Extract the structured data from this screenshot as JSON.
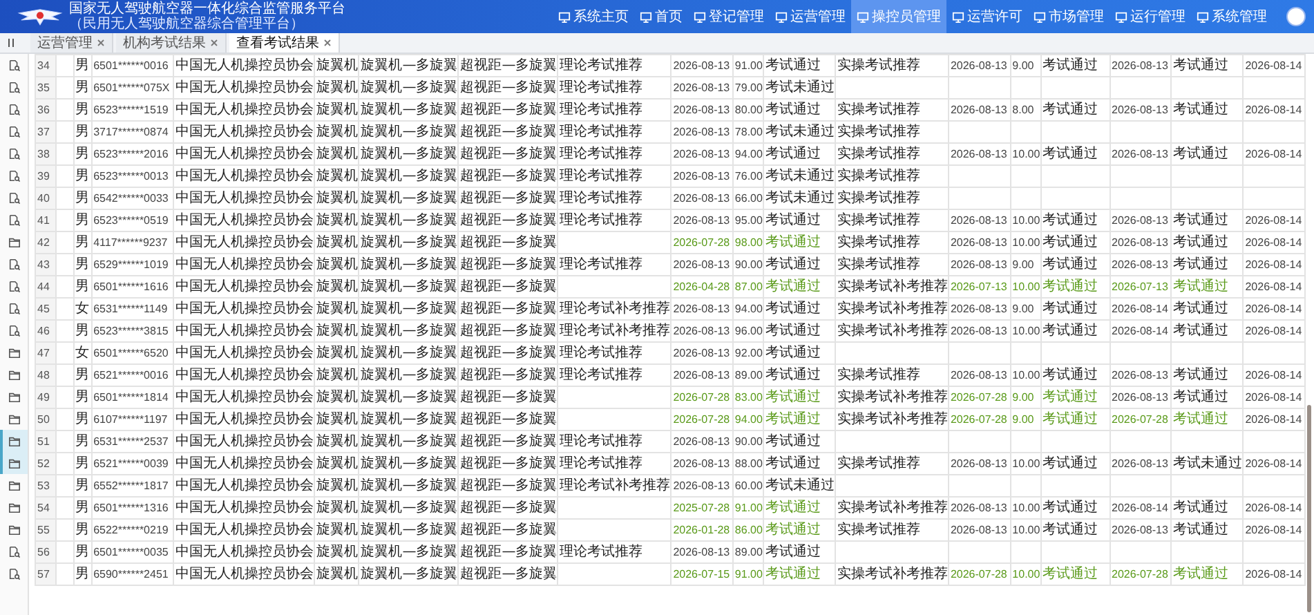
{
  "header": {
    "title": "国家无人驾驶航空器一体化综合监管服务平台",
    "subtitle": "（民用无人驾驶航空器综合管理平台）",
    "nav": [
      {
        "label": "系统主页",
        "selected": false
      },
      {
        "label": "首页",
        "selected": false
      },
      {
        "label": "登记管理",
        "selected": false
      },
      {
        "label": "运营管理",
        "selected": false
      },
      {
        "label": "操控员管理",
        "selected": true
      },
      {
        "label": "运营许可",
        "selected": false
      },
      {
        "label": "市场管理",
        "selected": false
      },
      {
        "label": "运行管理",
        "selected": false
      },
      {
        "label": "系统管理",
        "selected": false
      }
    ]
  },
  "tabs": [
    {
      "label": "运营管理",
      "selected": false
    },
    {
      "label": "机构考试结果",
      "selected": false
    },
    {
      "label": "查看考试结果",
      "selected": true
    }
  ],
  "sidebar": {
    "items": [
      {
        "kind": "doc",
        "selected": false
      },
      {
        "kind": "doc",
        "selected": false
      },
      {
        "kind": "doc",
        "selected": false
      },
      {
        "kind": "doc",
        "selected": false
      },
      {
        "kind": "doc",
        "selected": false
      },
      {
        "kind": "doc",
        "selected": false
      },
      {
        "kind": "doc",
        "selected": false
      },
      {
        "kind": "doc",
        "selected": false
      },
      {
        "kind": "folder",
        "selected": false
      },
      {
        "kind": "doc",
        "selected": false
      },
      {
        "kind": "doc",
        "selected": false
      },
      {
        "kind": "doc",
        "selected": false
      },
      {
        "kind": "doc",
        "selected": false
      },
      {
        "kind": "folder",
        "selected": false
      },
      {
        "kind": "folder",
        "selected": false
      },
      {
        "kind": "folder",
        "selected": false
      },
      {
        "kind": "folder",
        "selected": false
      },
      {
        "kind": "folder",
        "selected": true
      },
      {
        "kind": "folder",
        "selected": true
      },
      {
        "kind": "folder",
        "selected": false
      },
      {
        "kind": "folder",
        "selected": false
      },
      {
        "kind": "folder",
        "selected": false
      },
      {
        "kind": "doc",
        "selected": false
      },
      {
        "kind": "doc",
        "selected": false
      }
    ]
  },
  "table": {
    "rows": [
      {
        "no": "34",
        "gender": "男",
        "id_number": "6501******0016",
        "org": "中国无人机操控员协会",
        "aircraft": "旋翼机",
        "class": "旋翼机—多旋翼",
        "range": "超视距—多旋翼",
        "theory": {
          "recommend": "理论考试推荐",
          "date": "2026-08-13",
          "score": "91.00",
          "result": "考试通过",
          "highlight": false
        },
        "practical": {
          "recommend": "实操考试推荐",
          "date": "2026-08-13",
          "score": "9.00",
          "result": "考试通过",
          "highlight": false
        },
        "final": {
          "date": "2026-08-13",
          "result": "考试通过",
          "highlight": false
        },
        "issue_date": "2026-08-14"
      },
      {
        "no": "35",
        "gender": "男",
        "id_number": "6501******075X",
        "org": "中国无人机操控员协会",
        "aircraft": "旋翼机",
        "class": "旋翼机—多旋翼",
        "range": "超视距—多旋翼",
        "theory": {
          "recommend": "理论考试推荐",
          "date": "2026-08-13",
          "score": "79.00",
          "result": "考试未通过",
          "highlight": false
        }
      },
      {
        "no": "36",
        "gender": "男",
        "id_number": "6523******1519",
        "org": "中国无人机操控员协会",
        "aircraft": "旋翼机",
        "class": "旋翼机—多旋翼",
        "range": "超视距—多旋翼",
        "theory": {
          "recommend": "理论考试推荐",
          "date": "2026-08-13",
          "score": "80.00",
          "result": "考试通过",
          "highlight": false
        },
        "practical": {
          "recommend": "实操考试推荐",
          "date": "2026-08-13",
          "score": "8.00",
          "result": "考试通过",
          "highlight": false
        },
        "final": {
          "date": "2026-08-13",
          "result": "考试通过",
          "highlight": false
        },
        "issue_date": "2026-08-14"
      },
      {
        "no": "37",
        "gender": "男",
        "id_number": "3717******0874",
        "org": "中国无人机操控员协会",
        "aircraft": "旋翼机",
        "class": "旋翼机—多旋翼",
        "range": "超视距—多旋翼",
        "theory": {
          "recommend": "理论考试推荐",
          "date": "2026-08-13",
          "score": "78.00",
          "result": "考试未通过",
          "highlight": false
        },
        "practical": {
          "recommend": "实操考试推荐"
        }
      },
      {
        "no": "38",
        "gender": "男",
        "id_number": "6523******2016",
        "org": "中国无人机操控员协会",
        "aircraft": "旋翼机",
        "class": "旋翼机—多旋翼",
        "range": "超视距—多旋翼",
        "theory": {
          "recommend": "理论考试推荐",
          "date": "2026-08-13",
          "score": "94.00",
          "result": "考试通过",
          "highlight": false
        },
        "practical": {
          "recommend": "实操考试推荐",
          "date": "2026-08-13",
          "score": "10.00",
          "result": "考试通过",
          "highlight": false
        },
        "final": {
          "date": "2026-08-13",
          "result": "考试通过",
          "highlight": false
        },
        "issue_date": "2026-08-14"
      },
      {
        "no": "39",
        "gender": "男",
        "id_number": "6523******0013",
        "org": "中国无人机操控员协会",
        "aircraft": "旋翼机",
        "class": "旋翼机—多旋翼",
        "range": "超视距—多旋翼",
        "theory": {
          "recommend": "理论考试推荐",
          "date": "2026-08-13",
          "score": "76.00",
          "result": "考试未通过",
          "highlight": false
        },
        "practical": {
          "recommend": "实操考试推荐"
        }
      },
      {
        "no": "40",
        "gender": "男",
        "id_number": "6542******0033",
        "org": "中国无人机操控员协会",
        "aircraft": "旋翼机",
        "class": "旋翼机—多旋翼",
        "range": "超视距—多旋翼",
        "theory": {
          "recommend": "理论考试推荐",
          "date": "2026-08-13",
          "score": "66.00",
          "result": "考试未通过",
          "highlight": false
        },
        "practical": {
          "recommend": "实操考试推荐"
        }
      },
      {
        "no": "41",
        "gender": "男",
        "id_number": "6523******0519",
        "org": "中国无人机操控员协会",
        "aircraft": "旋翼机",
        "class": "旋翼机—多旋翼",
        "range": "超视距—多旋翼",
        "theory": {
          "recommend": "理论考试推荐",
          "date": "2026-08-13",
          "score": "95.00",
          "result": "考试通过",
          "highlight": false
        },
        "practical": {
          "recommend": "实操考试推荐",
          "date": "2026-08-13",
          "score": "10.00",
          "result": "考试通过",
          "highlight": false
        },
        "final": {
          "date": "2026-08-13",
          "result": "考试通过",
          "highlight": false
        },
        "issue_date": "2026-08-14"
      },
      {
        "no": "42",
        "gender": "男",
        "id_number": "4117******9237",
        "org": "中国无人机操控员协会",
        "aircraft": "旋翼机",
        "class": "旋翼机—多旋翼",
        "range": "超视距—多旋翼",
        "theory": {
          "date": "2026-07-28",
          "score": "98.00",
          "result": "考试通过",
          "highlight": true
        },
        "practical": {
          "recommend": "实操考试推荐",
          "date": "2026-08-13",
          "score": "10.00",
          "result": "考试通过",
          "highlight": false
        },
        "final": {
          "date": "2026-08-13",
          "result": "考试通过",
          "highlight": false
        },
        "issue_date": "2026-08-14"
      },
      {
        "no": "43",
        "gender": "男",
        "id_number": "6529******1019",
        "org": "中国无人机操控员协会",
        "aircraft": "旋翼机",
        "class": "旋翼机—多旋翼",
        "range": "超视距—多旋翼",
        "theory": {
          "recommend": "理论考试推荐",
          "date": "2026-08-13",
          "score": "90.00",
          "result": "考试通过",
          "highlight": false
        },
        "practical": {
          "recommend": "实操考试推荐",
          "date": "2026-08-13",
          "score": "9.00",
          "result": "考试通过",
          "highlight": false
        },
        "final": {
          "date": "2026-08-13",
          "result": "考试通过",
          "highlight": false
        },
        "issue_date": "2026-08-14"
      },
      {
        "no": "44",
        "gender": "男",
        "id_number": "6501******1616",
        "org": "中国无人机操控员协会",
        "aircraft": "旋翼机",
        "class": "旋翼机—多旋翼",
        "range": "超视距—多旋翼",
        "theory": {
          "date": "2026-04-28",
          "score": "87.00",
          "result": "考试通过",
          "highlight": true
        },
        "practical": {
          "recommend": "实操考试补考推荐",
          "date": "2026-07-13",
          "score": "10.00",
          "result": "考试通过",
          "highlight": true
        },
        "final": {
          "date": "2026-07-13",
          "result": "考试通过",
          "highlight": true
        },
        "issue_date": "2026-08-14"
      },
      {
        "no": "45",
        "gender": "女",
        "id_number": "6531******1149",
        "org": "中国无人机操控员协会",
        "aircraft": "旋翼机",
        "class": "旋翼机—多旋翼",
        "range": "超视距—多旋翼",
        "theory": {
          "recommend": "理论考试补考推荐",
          "date": "2026-08-13",
          "score": "94.00",
          "result": "考试通过",
          "highlight": false
        },
        "practical": {
          "recommend": "实操考试补考推荐",
          "date": "2026-08-13",
          "score": "9.00",
          "result": "考试通过",
          "highlight": false
        },
        "final": {
          "date": "2026-08-14",
          "result": "考试通过",
          "highlight": false
        },
        "issue_date": "2026-08-14"
      },
      {
        "no": "46",
        "gender": "男",
        "id_number": "6523******3815",
        "org": "中国无人机操控员协会",
        "aircraft": "旋翼机",
        "class": "旋翼机—多旋翼",
        "range": "超视距—多旋翼",
        "theory": {
          "recommend": "理论考试补考推荐",
          "date": "2026-08-13",
          "score": "96.00",
          "result": "考试通过",
          "highlight": false
        },
        "practical": {
          "recommend": "实操考试补考推荐",
          "date": "2026-08-13",
          "score": "10.00",
          "result": "考试通过",
          "highlight": false
        },
        "final": {
          "date": "2026-08-14",
          "result": "考试通过",
          "highlight": false
        },
        "issue_date": "2026-08-14"
      },
      {
        "no": "47",
        "gender": "女",
        "id_number": "6501******6520",
        "org": "中国无人机操控员协会",
        "aircraft": "旋翼机",
        "class": "旋翼机—多旋翼",
        "range": "超视距—多旋翼",
        "theory": {
          "recommend": "理论考试推荐",
          "date": "2026-08-13",
          "score": "92.00",
          "result": "考试通过",
          "highlight": false
        }
      },
      {
        "no": "48",
        "gender": "男",
        "id_number": "6521******0016",
        "org": "中国无人机操控员协会",
        "aircraft": "旋翼机",
        "class": "旋翼机—多旋翼",
        "range": "超视距—多旋翼",
        "theory": {
          "recommend": "理论考试推荐",
          "date": "2026-08-13",
          "score": "89.00",
          "result": "考试通过",
          "highlight": false
        },
        "practical": {
          "recommend": "实操考试推荐",
          "date": "2026-08-13",
          "score": "10.00",
          "result": "考试通过",
          "highlight": false
        },
        "final": {
          "date": "2026-08-13",
          "result": "考试通过",
          "highlight": false
        },
        "issue_date": "2026-08-14"
      },
      {
        "no": "49",
        "gender": "男",
        "id_number": "6501******1814",
        "org": "中国无人机操控员协会",
        "aircraft": "旋翼机",
        "class": "旋翼机—多旋翼",
        "range": "超视距—多旋翼",
        "theory": {
          "date": "2026-07-28",
          "score": "83.00",
          "result": "考试通过",
          "highlight": true
        },
        "practical": {
          "recommend": "实操考试补考推荐",
          "date": "2026-07-28",
          "score": "9.00",
          "result": "考试通过",
          "highlight": true
        },
        "final": {
          "date": "2026-08-13",
          "result": "考试通过",
          "highlight": false
        },
        "issue_date": "2026-08-14"
      },
      {
        "no": "50",
        "gender": "男",
        "id_number": "6107******1197",
        "org": "中国无人机操控员协会",
        "aircraft": "旋翼机",
        "class": "旋翼机—多旋翼",
        "range": "超视距—多旋翼",
        "theory": {
          "date": "2026-07-28",
          "score": "94.00",
          "result": "考试通过",
          "highlight": true
        },
        "practical": {
          "recommend": "实操考试补考推荐",
          "date": "2026-07-28",
          "score": "9.00",
          "result": "考试通过",
          "highlight": true
        },
        "final": {
          "date": "2026-07-28",
          "result": "考试通过",
          "highlight": true
        },
        "issue_date": "2026-08-14"
      },
      {
        "no": "51",
        "gender": "男",
        "id_number": "6531******2537",
        "org": "中国无人机操控员协会",
        "aircraft": "旋翼机",
        "class": "旋翼机—多旋翼",
        "range": "超视距—多旋翼",
        "theory": {
          "recommend": "理论考试推荐",
          "date": "2026-08-13",
          "score": "90.00",
          "result": "考试通过",
          "highlight": false
        }
      },
      {
        "no": "52",
        "gender": "男",
        "id_number": "6521******0039",
        "org": "中国无人机操控员协会",
        "aircraft": "旋翼机",
        "class": "旋翼机—多旋翼",
        "range": "超视距—多旋翼",
        "theory": {
          "recommend": "理论考试推荐",
          "date": "2026-08-13",
          "score": "88.00",
          "result": "考试通过",
          "highlight": false
        },
        "practical": {
          "recommend": "实操考试推荐",
          "date": "2026-08-13",
          "score": "10.00",
          "result": "考试通过",
          "highlight": false
        },
        "final": {
          "date": "2026-08-13",
          "result": "考试未通过",
          "highlight": false
        },
        "issue_date": "2026-08-14"
      },
      {
        "no": "53",
        "gender": "男",
        "id_number": "6552******1817",
        "org": "中国无人机操控员协会",
        "aircraft": "旋翼机",
        "class": "旋翼机—多旋翼",
        "range": "超视距—多旋翼",
        "theory": {
          "recommend": "理论考试补考推荐",
          "date": "2026-08-13",
          "score": "60.00",
          "result": "考试未通过",
          "highlight": false
        }
      },
      {
        "no": "54",
        "gender": "男",
        "id_number": "6501******1316",
        "org": "中国无人机操控员协会",
        "aircraft": "旋翼机",
        "class": "旋翼机—多旋翼",
        "range": "超视距—多旋翼",
        "theory": {
          "date": "2025-07-28",
          "score": "91.00",
          "result": "考试通过",
          "highlight": true
        },
        "practical": {
          "recommend": "实操考试补考推荐",
          "date": "2026-08-13",
          "score": "10.00",
          "result": "考试通过",
          "highlight": false
        },
        "final": {
          "date": "2026-08-14",
          "result": "考试通过",
          "highlight": false
        },
        "issue_date": "2026-08-14"
      },
      {
        "no": "55",
        "gender": "男",
        "id_number": "6522******0219",
        "org": "中国无人机操控员协会",
        "aircraft": "旋翼机",
        "class": "旋翼机—多旋翼",
        "range": "超视距—多旋翼",
        "theory": {
          "date": "2026-01-28",
          "score": "86.00",
          "result": "考试通过",
          "highlight": true
        },
        "practical": {
          "recommend": "实操考试推荐",
          "date": "2026-08-13",
          "score": "10.00",
          "result": "考试通过",
          "highlight": false
        },
        "final": {
          "date": "2026-08-13",
          "result": "考试通过",
          "highlight": false
        },
        "issue_date": "2026-08-14"
      },
      {
        "no": "56",
        "gender": "男",
        "id_number": "6501******0035",
        "org": "中国无人机操控员协会",
        "aircraft": "旋翼机",
        "class": "旋翼机—多旋翼",
        "range": "超视距—多旋翼",
        "theory": {
          "recommend": "理论考试推荐",
          "date": "2026-08-13",
          "score": "89.00",
          "result": "考试通过",
          "highlight": false
        }
      },
      {
        "no": "57",
        "gender": "男",
        "id_number": "6590******2451",
        "org": "中国无人机操控员协会",
        "aircraft": "旋翼机",
        "class": "旋翼机—多旋翼",
        "range": "超视距—多旋翼",
        "theory": {
          "date": "2026-07-15",
          "score": "91.00",
          "result": "考试通过",
          "highlight": true
        },
        "practical": {
          "recommend": "实操考试补考推荐",
          "date": "2026-07-28",
          "score": "10.00",
          "result": "考试通过",
          "highlight": true
        },
        "final": {
          "date": "2026-07-28",
          "result": "考试通过",
          "highlight": true
        },
        "issue_date": "2026-08-14"
      }
    ]
  }
}
